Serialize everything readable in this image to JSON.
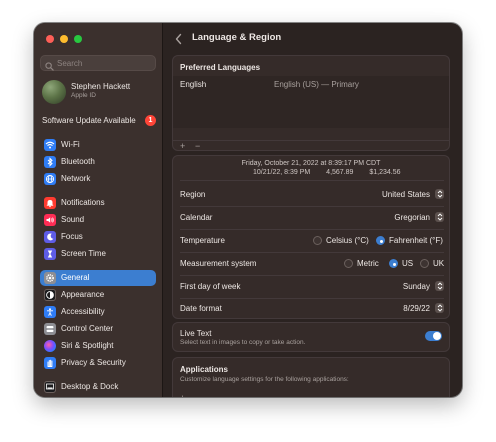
{
  "window": {
    "title": "Language & Region"
  },
  "sidebar": {
    "search_placeholder": "Search",
    "profile": {
      "name": "Stephen Hackett",
      "subtitle": "Apple ID"
    },
    "update": {
      "label": "Software Update Available",
      "badge": "1"
    },
    "items": [
      {
        "label": "Wi-Fi",
        "icon": "wifi-icon",
        "color": "#2f7df6"
      },
      {
        "label": "Bluetooth",
        "icon": "bluetooth-icon",
        "color": "#2f7df6"
      },
      {
        "label": "Network",
        "icon": "globe-icon",
        "color": "#2f7df6"
      },
      {
        "label": "Notifications",
        "icon": "bell-icon",
        "color": "#ff3b30"
      },
      {
        "label": "Sound",
        "icon": "speaker-icon",
        "color": "#ff2d55"
      },
      {
        "label": "Focus",
        "icon": "moon-icon",
        "color": "#5e5ce6"
      },
      {
        "label": "Screen Time",
        "icon": "hourglass-icon",
        "color": "#5e5ce6"
      },
      {
        "label": "General",
        "icon": "gear-icon",
        "color": "#8e8e93"
      },
      {
        "label": "Appearance",
        "icon": "appearance-icon",
        "color": "#1c1c1e"
      },
      {
        "label": "Accessibility",
        "icon": "accessibility-icon",
        "color": "#2f7df6"
      },
      {
        "label": "Control Center",
        "icon": "control-center-icon",
        "color": "#8e8e93"
      },
      {
        "label": "Siri & Spotlight",
        "icon": "siri-icon",
        "color": "#1c1c1e"
      },
      {
        "label": "Privacy & Security",
        "icon": "hand-icon",
        "color": "#2f7df6"
      },
      {
        "label": "Desktop & Dock",
        "icon": "dock-icon",
        "color": "#1c1c1e"
      }
    ],
    "selected": "General"
  },
  "preferred_languages": {
    "heading": "Preferred Languages",
    "items": [
      {
        "name": "English",
        "detail": "English (US) — Primary"
      }
    ],
    "add_label": "+",
    "remove_label": "−"
  },
  "format_preview": {
    "date_line": "Friday, October 21, 2022 at 8:39:17 PM CDT",
    "short_date": "10/21/22, 8:39 PM",
    "number": "4,567.89",
    "currency": "$1,234.56"
  },
  "settings": {
    "region": {
      "label": "Region",
      "value": "United States"
    },
    "calendar": {
      "label": "Calendar",
      "value": "Gregorian"
    },
    "temperature": {
      "label": "Temperature",
      "options": [
        "Celsius (°C)",
        "Fahrenheit (°F)"
      ],
      "selected": "Fahrenheit (°F)"
    },
    "measurement": {
      "label": "Measurement system",
      "options": [
        "Metric",
        "US",
        "UK"
      ],
      "selected": "US"
    },
    "first_day": {
      "label": "First day of week",
      "value": "Sunday"
    },
    "date_format": {
      "label": "Date format",
      "value": "8/29/22"
    }
  },
  "live_text": {
    "label": "Live Text",
    "description": "Select text in images to copy or take action.",
    "enabled": true
  },
  "applications": {
    "heading": "Applications",
    "description": "Customize language settings for the following applications:",
    "add_label": "+",
    "remove_label": "−"
  },
  "colors": {
    "accent": "#3c7ed0",
    "window_bg": "#2b2321",
    "sidebar_bg": "#3b302d"
  }
}
